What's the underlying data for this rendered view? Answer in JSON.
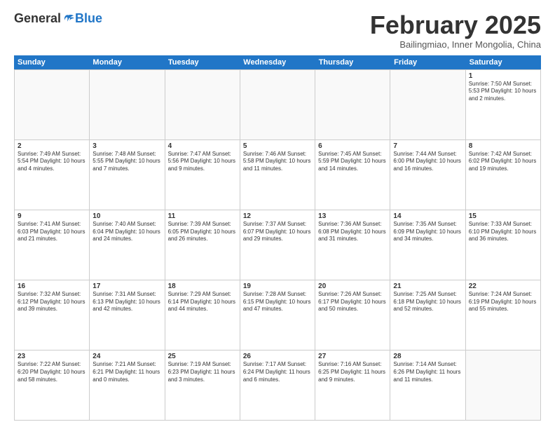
{
  "logo": {
    "general": "General",
    "blue": "Blue"
  },
  "title": "February 2025",
  "location": "Bailingmiao, Inner Mongolia, China",
  "days": [
    "Sunday",
    "Monday",
    "Tuesday",
    "Wednesday",
    "Thursday",
    "Friday",
    "Saturday"
  ],
  "weeks": [
    [
      {
        "day": "",
        "info": ""
      },
      {
        "day": "",
        "info": ""
      },
      {
        "day": "",
        "info": ""
      },
      {
        "day": "",
        "info": ""
      },
      {
        "day": "",
        "info": ""
      },
      {
        "day": "",
        "info": ""
      },
      {
        "day": "1",
        "info": "Sunrise: 7:50 AM\nSunset: 5:53 PM\nDaylight: 10 hours and 2 minutes."
      }
    ],
    [
      {
        "day": "2",
        "info": "Sunrise: 7:49 AM\nSunset: 5:54 PM\nDaylight: 10 hours and 4 minutes."
      },
      {
        "day": "3",
        "info": "Sunrise: 7:48 AM\nSunset: 5:55 PM\nDaylight: 10 hours and 7 minutes."
      },
      {
        "day": "4",
        "info": "Sunrise: 7:47 AM\nSunset: 5:56 PM\nDaylight: 10 hours and 9 minutes."
      },
      {
        "day": "5",
        "info": "Sunrise: 7:46 AM\nSunset: 5:58 PM\nDaylight: 10 hours and 11 minutes."
      },
      {
        "day": "6",
        "info": "Sunrise: 7:45 AM\nSunset: 5:59 PM\nDaylight: 10 hours and 14 minutes."
      },
      {
        "day": "7",
        "info": "Sunrise: 7:44 AM\nSunset: 6:00 PM\nDaylight: 10 hours and 16 minutes."
      },
      {
        "day": "8",
        "info": "Sunrise: 7:42 AM\nSunset: 6:02 PM\nDaylight: 10 hours and 19 minutes."
      }
    ],
    [
      {
        "day": "9",
        "info": "Sunrise: 7:41 AM\nSunset: 6:03 PM\nDaylight: 10 hours and 21 minutes."
      },
      {
        "day": "10",
        "info": "Sunrise: 7:40 AM\nSunset: 6:04 PM\nDaylight: 10 hours and 24 minutes."
      },
      {
        "day": "11",
        "info": "Sunrise: 7:39 AM\nSunset: 6:05 PM\nDaylight: 10 hours and 26 minutes."
      },
      {
        "day": "12",
        "info": "Sunrise: 7:37 AM\nSunset: 6:07 PM\nDaylight: 10 hours and 29 minutes."
      },
      {
        "day": "13",
        "info": "Sunrise: 7:36 AM\nSunset: 6:08 PM\nDaylight: 10 hours and 31 minutes."
      },
      {
        "day": "14",
        "info": "Sunrise: 7:35 AM\nSunset: 6:09 PM\nDaylight: 10 hours and 34 minutes."
      },
      {
        "day": "15",
        "info": "Sunrise: 7:33 AM\nSunset: 6:10 PM\nDaylight: 10 hours and 36 minutes."
      }
    ],
    [
      {
        "day": "16",
        "info": "Sunrise: 7:32 AM\nSunset: 6:12 PM\nDaylight: 10 hours and 39 minutes."
      },
      {
        "day": "17",
        "info": "Sunrise: 7:31 AM\nSunset: 6:13 PM\nDaylight: 10 hours and 42 minutes."
      },
      {
        "day": "18",
        "info": "Sunrise: 7:29 AM\nSunset: 6:14 PM\nDaylight: 10 hours and 44 minutes."
      },
      {
        "day": "19",
        "info": "Sunrise: 7:28 AM\nSunset: 6:15 PM\nDaylight: 10 hours and 47 minutes."
      },
      {
        "day": "20",
        "info": "Sunrise: 7:26 AM\nSunset: 6:17 PM\nDaylight: 10 hours and 50 minutes."
      },
      {
        "day": "21",
        "info": "Sunrise: 7:25 AM\nSunset: 6:18 PM\nDaylight: 10 hours and 52 minutes."
      },
      {
        "day": "22",
        "info": "Sunrise: 7:24 AM\nSunset: 6:19 PM\nDaylight: 10 hours and 55 minutes."
      }
    ],
    [
      {
        "day": "23",
        "info": "Sunrise: 7:22 AM\nSunset: 6:20 PM\nDaylight: 10 hours and 58 minutes."
      },
      {
        "day": "24",
        "info": "Sunrise: 7:21 AM\nSunset: 6:21 PM\nDaylight: 11 hours and 0 minutes."
      },
      {
        "day": "25",
        "info": "Sunrise: 7:19 AM\nSunset: 6:23 PM\nDaylight: 11 hours and 3 minutes."
      },
      {
        "day": "26",
        "info": "Sunrise: 7:17 AM\nSunset: 6:24 PM\nDaylight: 11 hours and 6 minutes."
      },
      {
        "day": "27",
        "info": "Sunrise: 7:16 AM\nSunset: 6:25 PM\nDaylight: 11 hours and 9 minutes."
      },
      {
        "day": "28",
        "info": "Sunrise: 7:14 AM\nSunset: 6:26 PM\nDaylight: 11 hours and 11 minutes."
      },
      {
        "day": "",
        "info": ""
      }
    ]
  ]
}
